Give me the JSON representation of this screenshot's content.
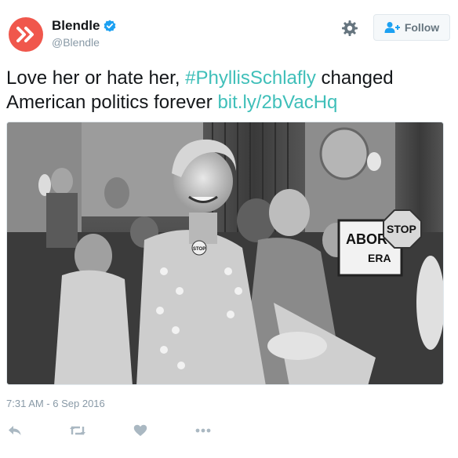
{
  "account": {
    "display_name": "Blendle",
    "handle": "@Blendle",
    "verified": true,
    "brand_color": "#f0574c",
    "avatar_icon": "double-chevron-icon"
  },
  "header": {
    "settings_icon": "gear-icon",
    "follow_label": "Follow",
    "follow_icon": "add-user-icon"
  },
  "tweet": {
    "text_before": "Love her or hate her, ",
    "hashtag": "#PhyllisSchlafly",
    "text_middle": " changed American politics forever ",
    "link": "bit.ly/2bVacHq",
    "link_color": "#3fbfb9",
    "photo": {
      "description_icon": "black-and-white-photo",
      "sign_text_1": "ABOR",
      "sign_text_2": "ERA",
      "sign_text_3": "STOP",
      "button_text": "STOP"
    }
  },
  "timestamp": "7:31 AM - 6 Sep 2016",
  "actions": {
    "reply_icon": "reply-icon",
    "retweet_icon": "retweet-icon",
    "like_icon": "heart-icon",
    "more_icon": "more-icon"
  }
}
